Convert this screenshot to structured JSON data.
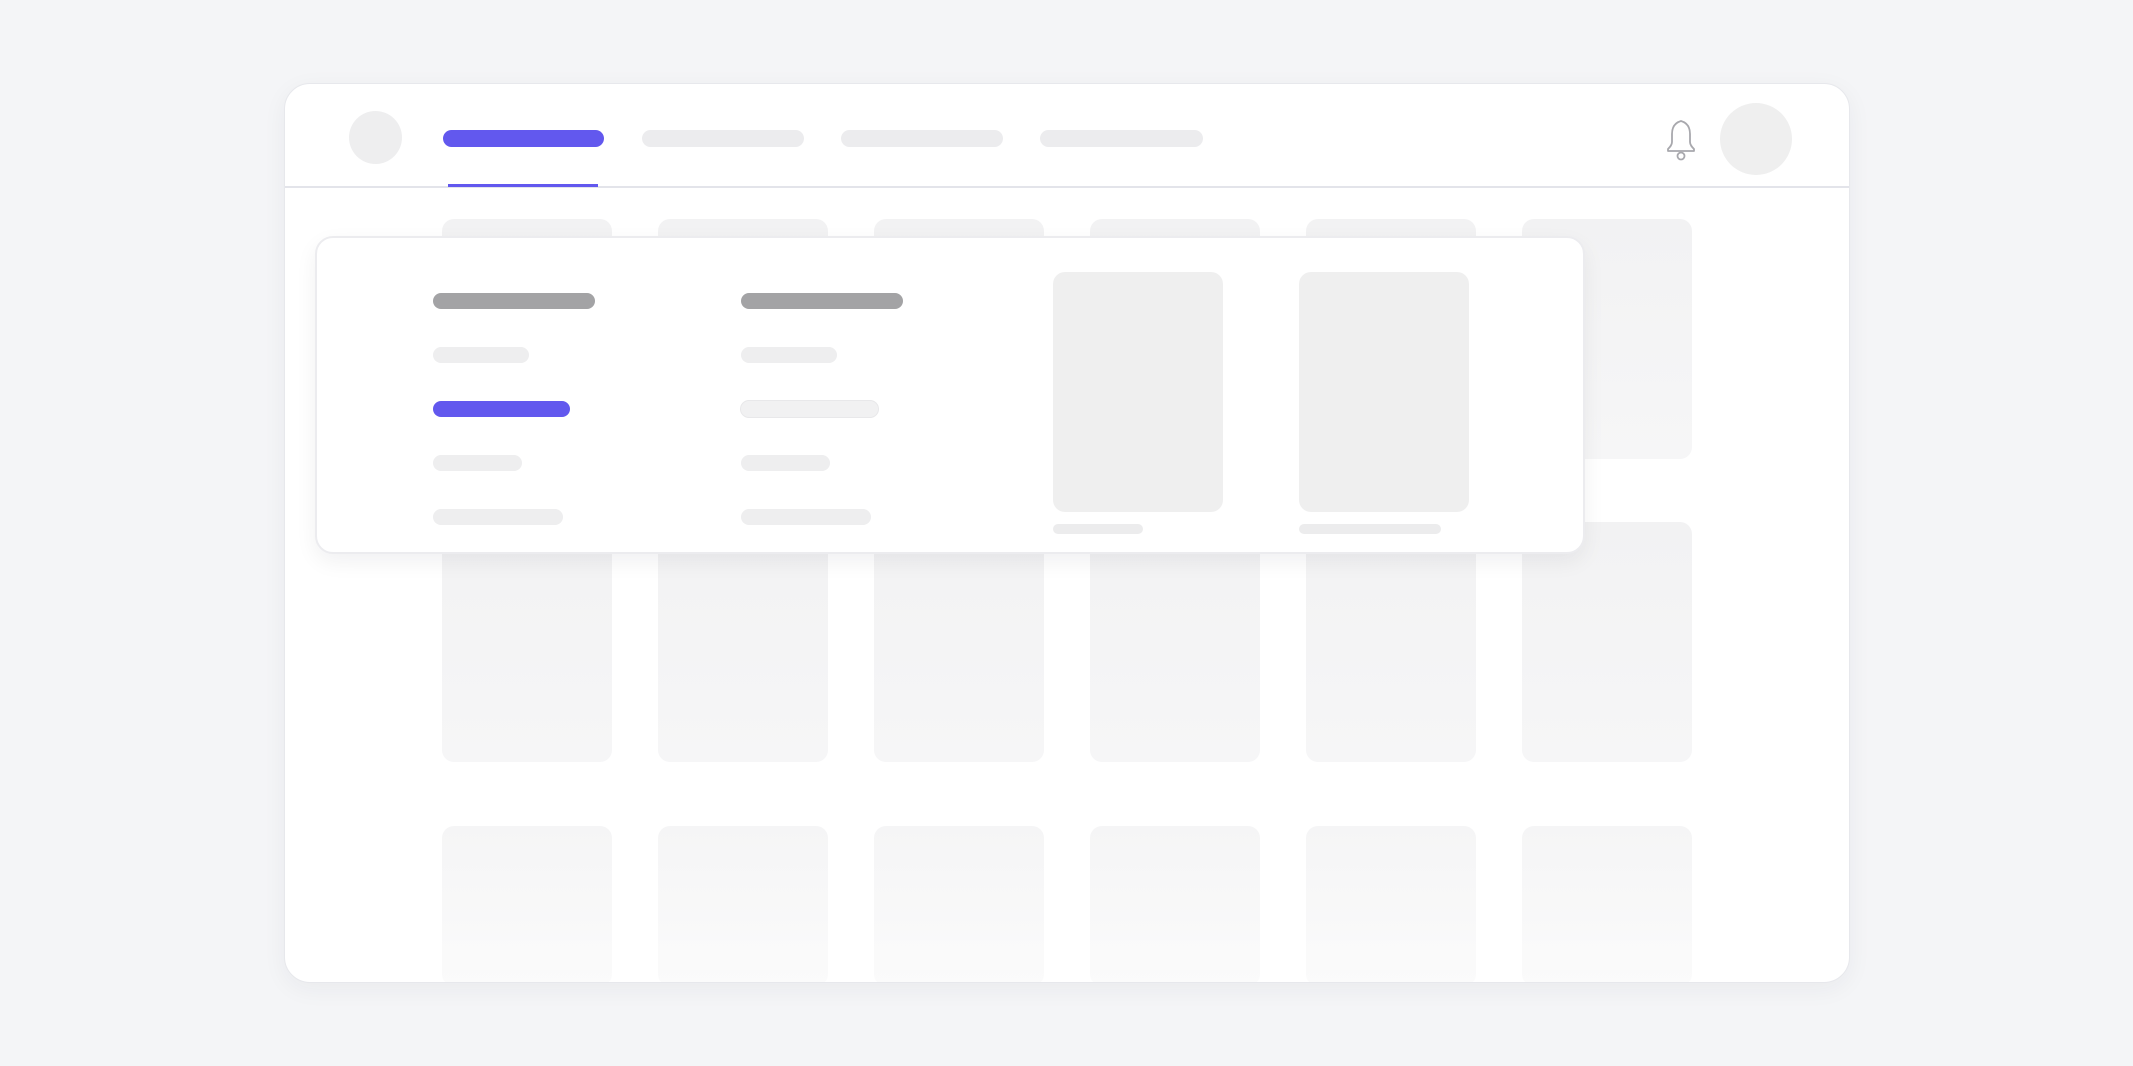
{
  "app": {
    "nav": {
      "tabs": [
        {
          "id": "tab-1",
          "label": "",
          "active": true
        },
        {
          "id": "tab-2",
          "label": "",
          "active": false
        },
        {
          "id": "tab-3",
          "label": "",
          "active": false
        },
        {
          "id": "tab-4",
          "label": "",
          "active": false
        }
      ]
    },
    "icons": {
      "logo": "logo-placeholder",
      "notifications": "bell-icon",
      "user": "avatar-placeholder"
    },
    "colors": {
      "accent": "#6258ee",
      "placeholder": "#eeeeef",
      "heading_placeholder": "#a3a3a5",
      "background": "#f4f5f7",
      "surface": "#ffffff"
    }
  },
  "mega_menu": {
    "columns": [
      {
        "heading": "",
        "items": [
          {
            "label": "",
            "active": false
          },
          {
            "label": "",
            "active": true
          },
          {
            "label": "",
            "active": false
          },
          {
            "label": "",
            "active": false
          }
        ]
      },
      {
        "heading": "",
        "items": [
          {
            "label": "",
            "active": false
          },
          {
            "label": "",
            "active": false
          },
          {
            "label": "",
            "active": false
          },
          {
            "label": "",
            "active": false
          }
        ]
      }
    ],
    "promos": [
      {
        "caption": ""
      },
      {
        "caption": ""
      }
    ]
  },
  "content_grid": {
    "rows": 3,
    "columns": 6
  }
}
